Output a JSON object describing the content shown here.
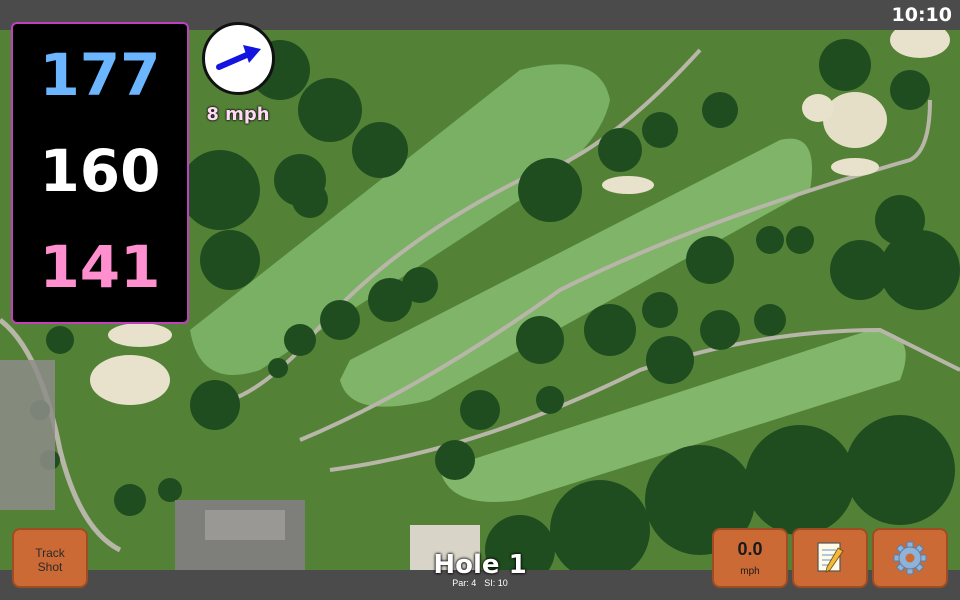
{
  "status": {
    "time": "10:10"
  },
  "distances": {
    "back": "177",
    "middle": "160",
    "front": "141"
  },
  "wind": {
    "speed_label": "8 mph",
    "icon": "wind-direction-arrow-icon"
  },
  "hole": {
    "title": "Hole 1",
    "par": "Par: 4",
    "stroke_index": "SI: 10"
  },
  "buttons": {
    "track_shot_line1": "Track",
    "track_shot_line2": "Shot",
    "speed_value": "0.0",
    "speed_unit": "mph",
    "notes_icon": "notepad-icon",
    "settings_icon": "gear-icon"
  },
  "colors": {
    "back_distance": "#6bb6ff",
    "middle_distance": "#ffffff",
    "front_distance": "#ff8fcf",
    "button_bg": "#cc6a36",
    "panel_border": "#c040c0"
  }
}
